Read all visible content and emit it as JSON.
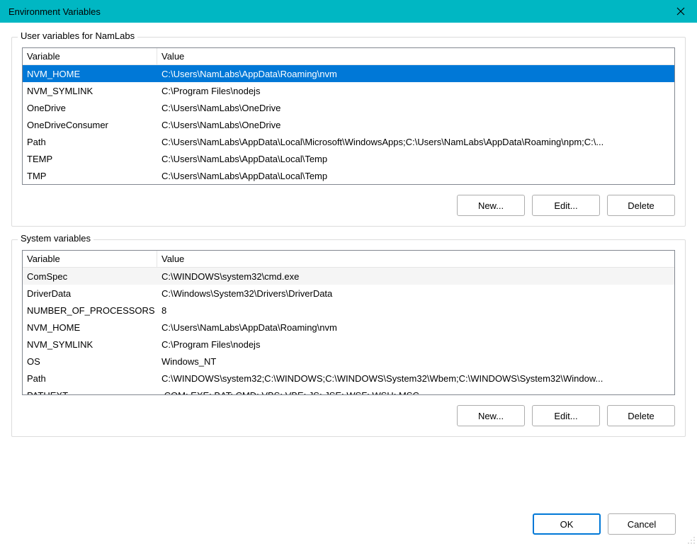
{
  "window": {
    "title": "Environment Variables"
  },
  "user_section": {
    "legend": "User variables for NamLabs",
    "headers": {
      "variable": "Variable",
      "value": "Value"
    },
    "rows": [
      {
        "variable": "NVM_HOME",
        "value": "C:\\Users\\NamLabs\\AppData\\Roaming\\nvm",
        "selected": true
      },
      {
        "variable": "NVM_SYMLINK",
        "value": "C:\\Program Files\\nodejs"
      },
      {
        "variable": "OneDrive",
        "value": "C:\\Users\\NamLabs\\OneDrive"
      },
      {
        "variable": "OneDriveConsumer",
        "value": "C:\\Users\\NamLabs\\OneDrive"
      },
      {
        "variable": "Path",
        "value": "C:\\Users\\NamLabs\\AppData\\Local\\Microsoft\\WindowsApps;C:\\Users\\NamLabs\\AppData\\Roaming\\npm;C:\\..."
      },
      {
        "variable": "TEMP",
        "value": "C:\\Users\\NamLabs\\AppData\\Local\\Temp"
      },
      {
        "variable": "TMP",
        "value": "C:\\Users\\NamLabs\\AppData\\Local\\Temp"
      }
    ],
    "buttons": {
      "new": "New...",
      "edit": "Edit...",
      "delete": "Delete"
    }
  },
  "system_section": {
    "legend": "System variables",
    "headers": {
      "variable": "Variable",
      "value": "Value"
    },
    "rows": [
      {
        "variable": "ComSpec",
        "value": "C:\\WINDOWS\\system32\\cmd.exe",
        "alt": true
      },
      {
        "variable": "DriverData",
        "value": "C:\\Windows\\System32\\Drivers\\DriverData"
      },
      {
        "variable": "NUMBER_OF_PROCESSORS",
        "value": "8"
      },
      {
        "variable": "NVM_HOME",
        "value": "C:\\Users\\NamLabs\\AppData\\Roaming\\nvm"
      },
      {
        "variable": "NVM_SYMLINK",
        "value": "C:\\Program Files\\nodejs"
      },
      {
        "variable": "OS",
        "value": "Windows_NT"
      },
      {
        "variable": "Path",
        "value": "C:\\WINDOWS\\system32;C:\\WINDOWS;C:\\WINDOWS\\System32\\Wbem;C:\\WINDOWS\\System32\\Window..."
      },
      {
        "variable": "PATHEXT",
        "value": ".COM;.EXE;.BAT;.CMD;.VBS;.VBE;.JS;.JSE;.WSF;.WSH;.MSC"
      }
    ],
    "buttons": {
      "new": "New...",
      "edit": "Edit...",
      "delete": "Delete"
    }
  },
  "dialog_buttons": {
    "ok": "OK",
    "cancel": "Cancel"
  }
}
